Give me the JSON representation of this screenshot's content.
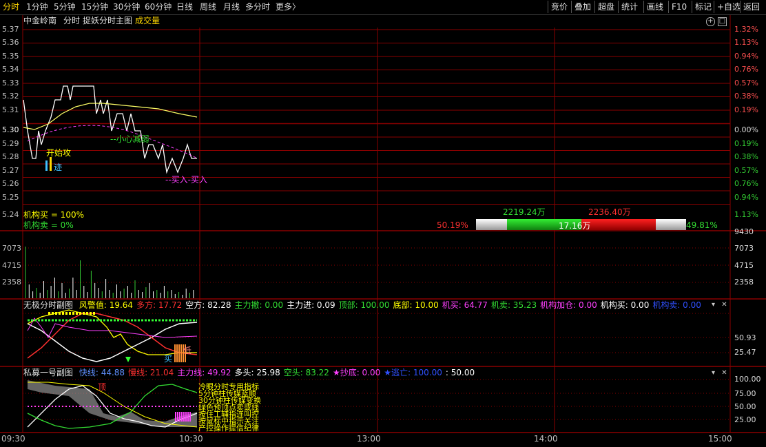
{
  "tabs": [
    {
      "label": "分时",
      "active": true
    },
    {
      "label": "1分钟"
    },
    {
      "label": "5分钟"
    },
    {
      "label": "15分钟"
    },
    {
      "label": "30分钟"
    },
    {
      "label": "60分钟"
    },
    {
      "label": "日线"
    },
    {
      "label": "周线"
    },
    {
      "label": "月线"
    },
    {
      "label": "多分时"
    },
    {
      "label": "更多"
    }
  ],
  "more_arrow": "〉",
  "right_buttons": [
    "竞价",
    "叠加",
    "超盘",
    "统计",
    "画线",
    "F10",
    "标记",
    "+自选",
    "返回"
  ],
  "main_header": {
    "stock": "中金岭南",
    "mode": "分时",
    "indicator": "捉妖分时主图",
    "volume": "成交量"
  },
  "price_axis_left": [
    "5.37",
    "5.36",
    "5.35",
    "5.34",
    "5.33",
    "5.32",
    "5.31",
    "5.30",
    "5.29",
    "5.28",
    "5.27",
    "5.26",
    "5.25",
    "5.24"
  ],
  "pct_axis_right": [
    "1.32%",
    "1.13%",
    "0.94%",
    "0.76%",
    "0.57%",
    "0.38%",
    "0.19%",
    "0.00%",
    "0.19%",
    "0.38%",
    "0.57%",
    "0.76%",
    "0.94%",
    "1.13%"
  ],
  "annotations": {
    "attack": "开始攻",
    "trace": "迹",
    "careful": "--小心减弱",
    "buy": "--买入-买入"
  },
  "institution": {
    "buy": "机构买 = 100%",
    "sell": "机构卖 = 0%"
  },
  "bar_widget": {
    "left_pct": "50.19%",
    "right_pct": "49.81%",
    "left_val": "2219.24万",
    "right_val": "2236.40万",
    "center_val": "17.16万"
  },
  "volume_axis": [
    "9430",
    "7073",
    "4715",
    "2358"
  ],
  "sub1": {
    "name": "无极分时副图",
    "items": [
      {
        "label": "风警值:",
        "value": "19.64",
        "color": "#ffff00"
      },
      {
        "label": "多方:",
        "value": "17.72",
        "color": "#ff3030"
      },
      {
        "label": "空方:",
        "value": "82.28",
        "color": "#ffffff"
      },
      {
        "label": "主力撤:",
        "value": "0.00",
        "color": "#33dd33"
      },
      {
        "label": "主力进:",
        "value": "0.09",
        "color": "#ffffff"
      },
      {
        "label": "顶部:",
        "value": "100.00",
        "color": "#33dd33"
      },
      {
        "label": "底部:",
        "value": "10.00",
        "color": "#ffff00"
      },
      {
        "label": "机买:",
        "value": "64.77",
        "color": "#ff40ff"
      },
      {
        "label": "机卖:",
        "value": "35.23",
        "color": "#33dd33"
      },
      {
        "label": "机构加仓:",
        "value": "0.00",
        "color": "#ff40ff"
      },
      {
        "label": "机构买:",
        "value": "0.00",
        "color": "#ffffff"
      },
      {
        "label": "机构卖:",
        "value": "0.00",
        "color": "#3050ff"
      }
    ],
    "axis": [
      "50.93",
      "25.47"
    ],
    "marks": {
      "low": "低",
      "buy": "买"
    }
  },
  "sub2": {
    "name": "私募一号副图",
    "items": [
      {
        "label": "快线:",
        "value": "44.88",
        "color": "#6090ff"
      },
      {
        "label": "慢线:",
        "value": "21.04",
        "color": "#ff3030"
      },
      {
        "label": "主力线:",
        "value": "49.92",
        "color": "#ff40ff"
      },
      {
        "label": "多头:",
        "value": "25.98",
        "color": "#ffffff"
      },
      {
        "label": "空头:",
        "value": "83.22",
        "color": "#33dd33"
      },
      {
        "label": "★抄底:",
        "value": "0.00",
        "color": "#ff40ff"
      },
      {
        "label": "★逃亡:",
        "value": "100.00",
        "color": "#3050ff"
      },
      {
        "label": ":",
        "value": "50.00",
        "color": "#ffffff"
      }
    ],
    "axis": [
      "100.00",
      "75.00",
      "50.00",
      "25.00"
    ],
    "top_mark": "顶",
    "legend": [
      "冷眼分时专用指标",
      "5分钟柱传媒蓝顺",
      "30分钟柱传媒变换",
      "绿色预顶点卖或线",
      "按住工辅指连叫控",
      "按鼠标中指示关注",
      "产控操作提信纪律"
    ]
  },
  "time_axis": [
    "09:30",
    "10:30",
    "13:00",
    "14:00",
    "15:00"
  ],
  "colors": {
    "grid": "#8b0000",
    "up": "#ff3030",
    "down": "#33cc33",
    "price": "#ffffff",
    "avg": "#ffff66"
  }
}
